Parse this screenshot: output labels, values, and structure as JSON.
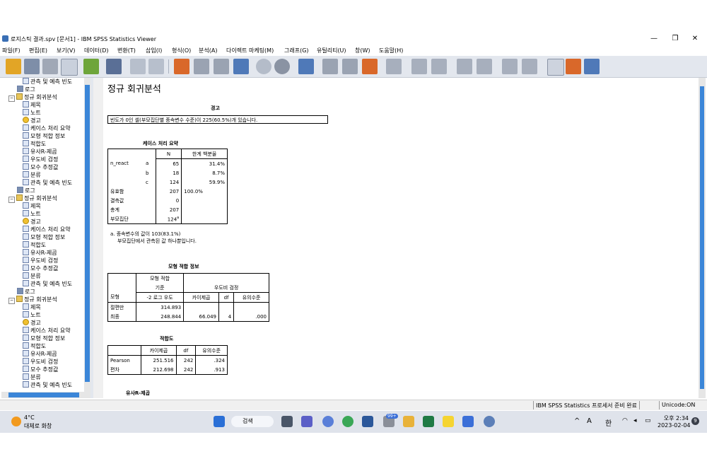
{
  "window": {
    "title": "로지스틱 결과.spv [문서1] - IBM SPSS Statistics Viewer",
    "minimize": "—",
    "maximize": "❐",
    "close": "✕"
  },
  "menu": [
    "파일(F)",
    "편집(E)",
    "보기(V)",
    "데이터(D)",
    "변환(T)",
    "삽입(I)",
    "형식(O)",
    "분석(A)",
    "다이렉트 마케팅(M)",
    "그래프(G)",
    "유틸리티(U)",
    "창(W)",
    "도움말(H)"
  ],
  "tree": {
    "row0": "관측 및 예측 빈도",
    "log": "로그",
    "analysis": "정규 회귀분석",
    "title": "제목",
    "notes": "노트",
    "warning": "경고",
    "case_summary": "케이스 처리 요약",
    "model_fit": "모형 적합 정보",
    "goodness": "적합도",
    "pseudo_r2": "유사R-제곱",
    "lr_test": "우도비 검정",
    "param": "모수 추정값",
    "classification": "분류",
    "observed_pred": "관측 및 예측 빈도"
  },
  "output": {
    "heading": "정규 회귀분석",
    "warning_title": "경고",
    "warning_text": "빈도가 0인 셀(부모집단별 종속변수 수준)이 225(60.5%)개 있습니다.",
    "case_title": "케이스 처리 요약",
    "case_header_n": "N",
    "case_header_pct": "한계 백분율",
    "case_var": "n_react",
    "case_rows": [
      {
        "label": "a",
        "n": "65",
        "pct": "31.4%"
      },
      {
        "label": "b",
        "n": "18",
        "pct": "8.7%"
      },
      {
        "label": "c",
        "n": "124",
        "pct": "59.9%"
      }
    ],
    "valid_label": "유효함",
    "valid_n": "207",
    "valid_pct": "100.0%",
    "missing_label": "결측값",
    "missing_n": "0",
    "total_label": "총계",
    "total_n": "207",
    "subpop_label": "부모집단",
    "subpop_n": "124",
    "subpop_sup": "a",
    "case_foot1": "a. 종속변수의 값이 103(83.1%)",
    "case_foot2": "부모집단에서 관측된 값 하나뿐입니다.",
    "fit_title": "모형 적합 정보",
    "fit_crit_hdr1": "모형 적합",
    "fit_crit_hdr2": "기준",
    "fit_lr_hdr": "우도비 검정",
    "fit_model_hdr": "모형",
    "fit_col1": "-2 로그 우도",
    "fit_col2": "카이제곱",
    "fit_col3": "df",
    "fit_col4": "유의수준",
    "fit_rows": [
      {
        "label": "절편만",
        "ll": "314.893",
        "chi": "",
        "df": "",
        "sig": ""
      },
      {
        "label": "최종",
        "ll": "248.844",
        "chi": "66.049",
        "df": "4",
        "sig": ".000"
      }
    ],
    "gof_title": "적합도",
    "gof_col1": "카이제곱",
    "gof_col2": "df",
    "gof_col3": "유의수준",
    "gof_rows": [
      {
        "label": "Pearson",
        "chi": "251.516",
        "df": "242",
        "sig": ".324"
      },
      {
        "label": "편차",
        "chi": "212.698",
        "df": "242",
        "sig": ".913"
      }
    ],
    "pseudo_title": "유사R-제곱"
  },
  "status": {
    "processor": "IBM SPSS Statistics 프로세서 준비 완료",
    "encoding": "Unicode:ON"
  },
  "taskbar": {
    "weather_temp": "4°C",
    "weather_desc": "대체로 화창",
    "search": "검색",
    "badge": "99+",
    "tray_a": "A",
    "tray_lang": "한",
    "time": "오후 2:34",
    "date": "2023-02-04",
    "notif": "9"
  }
}
